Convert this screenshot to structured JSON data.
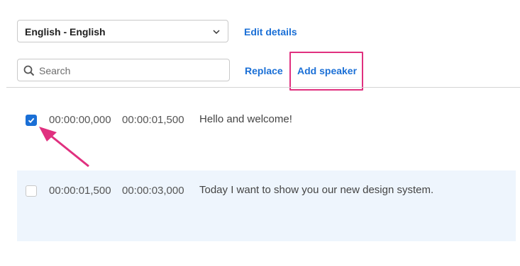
{
  "language_select": {
    "value": "English - English"
  },
  "edit_details_label": "Edit details",
  "search": {
    "placeholder": "Search",
    "value": ""
  },
  "replace_label": "Replace",
  "add_speaker_label": "Add speaker",
  "colors": {
    "accent": "#1a6fd6",
    "highlight": "#e0307f",
    "row_alt_bg": "#eef5fd"
  },
  "rows": [
    {
      "checked": true,
      "start": "00:00:00,000",
      "end": "00:00:01,500",
      "text": "Hello and welcome!"
    },
    {
      "checked": false,
      "start": "00:00:01,500",
      "end": "00:00:03,000",
      "text": "Today I want to show you our new design system."
    }
  ]
}
